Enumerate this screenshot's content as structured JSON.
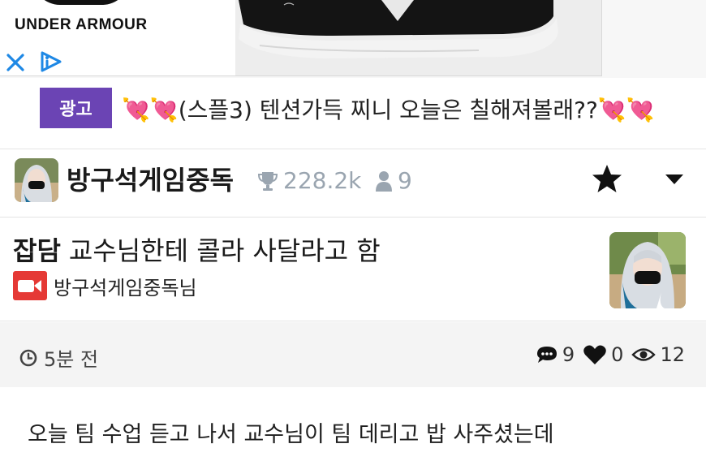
{
  "ad": {
    "brand_text": "UNDER ARMOUR",
    "close_icon": "close-x-icon",
    "adchoices_icon": "adchoices-icon",
    "product": "sneaker-image",
    "colors": {
      "sneaker_upper": "#141414",
      "sneaker_sole": "#f3f3f3",
      "background": "#ededed"
    }
  },
  "promo": {
    "badge": "광고",
    "text": "💘💘(스플3) 텐션가득 찌니 오늘은 칠해져볼래??💘💘",
    "badge_color": "#6b44b4"
  },
  "channel": {
    "name": "방구석게임중독",
    "followers": "228.2k",
    "members": "9",
    "trophy_icon": "trophy-icon",
    "user_icon": "user-icon",
    "star_icon": "star-icon",
    "dropdown_icon": "caret-down-icon",
    "stat_color": "#9aa5b0"
  },
  "post": {
    "category": "잡담",
    "title": "교수님한테 콜라 사달라고 함",
    "author": "방구석게임중독님",
    "author_badge_color": "#e53935",
    "time": "5분 전",
    "comments": "9",
    "likes": "0",
    "views": "12",
    "body_first_line": "오늘 팀 수업 듣고 나서 교수님이 팀 데리고 밥 사주셨는데"
  }
}
